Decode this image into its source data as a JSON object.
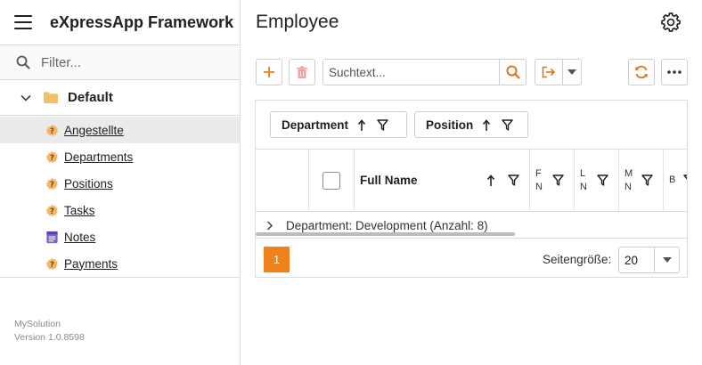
{
  "app": {
    "title": "eXpressApp Framework",
    "about_name": "MySolution",
    "about_version": "Version 1.0.8598"
  },
  "nav": {
    "filter_placeholder": "Filter...",
    "group": "Default",
    "items": [
      {
        "label": "Angestellte",
        "icon": "bo-unknown-icon",
        "active": true
      },
      {
        "label": "Departments",
        "icon": "bo-unknown-icon"
      },
      {
        "label": "Positions",
        "icon": "bo-unknown-icon"
      },
      {
        "label": "Tasks",
        "icon": "bo-unknown-icon"
      },
      {
        "label": "Notes",
        "icon": "note-icon"
      },
      {
        "label": "Payments",
        "icon": "bo-unknown-icon"
      }
    ]
  },
  "view": {
    "title": "Employee"
  },
  "toolbar": {
    "search_placeholder": "Suchtext..."
  },
  "grid": {
    "group_chips": [
      {
        "label": "Department"
      },
      {
        "label": "Position"
      }
    ],
    "columns": {
      "full_name": "Full Name",
      "col_f_top": "F",
      "col_f_bot": "N",
      "col_l_top": "L",
      "col_l_bot": "N",
      "col_m_top": "M",
      "col_m_bot": "N",
      "col_b": "B"
    },
    "group_row": "Department: Development (Anzahl: 8)"
  },
  "pager": {
    "current_page": "1",
    "page_size_label": "Seitengröße:",
    "page_size": "20"
  },
  "colors": {
    "accent": "#f0821e",
    "delete_disabled": "#f2a0a0"
  }
}
